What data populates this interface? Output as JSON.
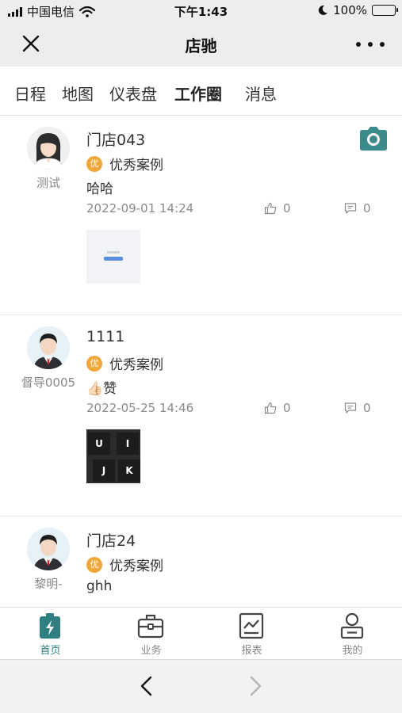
{
  "status_bar": {
    "carrier": "中国电信",
    "time": "下午1:43",
    "battery": "100%"
  },
  "nav": {
    "title": "店驰",
    "close_icon": "close-icon",
    "more_icon": "more-dots-icon"
  },
  "tabs": [
    {
      "label": "日程",
      "active": false
    },
    {
      "label": "地图",
      "active": false
    },
    {
      "label": "仪表盘",
      "active": false
    },
    {
      "label": "工作圈",
      "active": true
    },
    {
      "label": "消息",
      "active": false
    }
  ],
  "posts": [
    {
      "author": "测试",
      "avatar": "female-avatar",
      "title": "门店043",
      "badge_icon_text": "优",
      "badge": "优秀案例",
      "text": "哈哈",
      "time": "2022-09-01 14:24",
      "likes": "0",
      "comments": "0",
      "image": "screenshot-thumbnail"
    },
    {
      "author": "督导0005",
      "avatar": "male-avatar",
      "title": "1111",
      "badge_icon_text": "优",
      "badge": "优秀案例",
      "text_emoji": "👍🏻",
      "text": "赞",
      "time": "2022-05-25 14:46",
      "likes": "0",
      "comments": "0",
      "image": "keyboard-photo",
      "keys": [
        "U",
        "I",
        "J",
        "K"
      ]
    },
    {
      "author": "黎明-",
      "avatar": "male-avatar",
      "title": "门店24",
      "badge_icon_text": "优",
      "badge": "优秀案例",
      "text": "ghh"
    }
  ],
  "tabbar": [
    {
      "label": "首页",
      "icon": "home-icon",
      "active": true
    },
    {
      "label": "业务",
      "icon": "briefcase-icon",
      "active": false
    },
    {
      "label": "报表",
      "icon": "report-chart-icon",
      "active": false
    },
    {
      "label": "我的",
      "icon": "profile-icon",
      "active": false
    }
  ],
  "colors": {
    "accent": "#2f7f80",
    "badge": "#f0a73a",
    "bar_background": "#ededed"
  }
}
